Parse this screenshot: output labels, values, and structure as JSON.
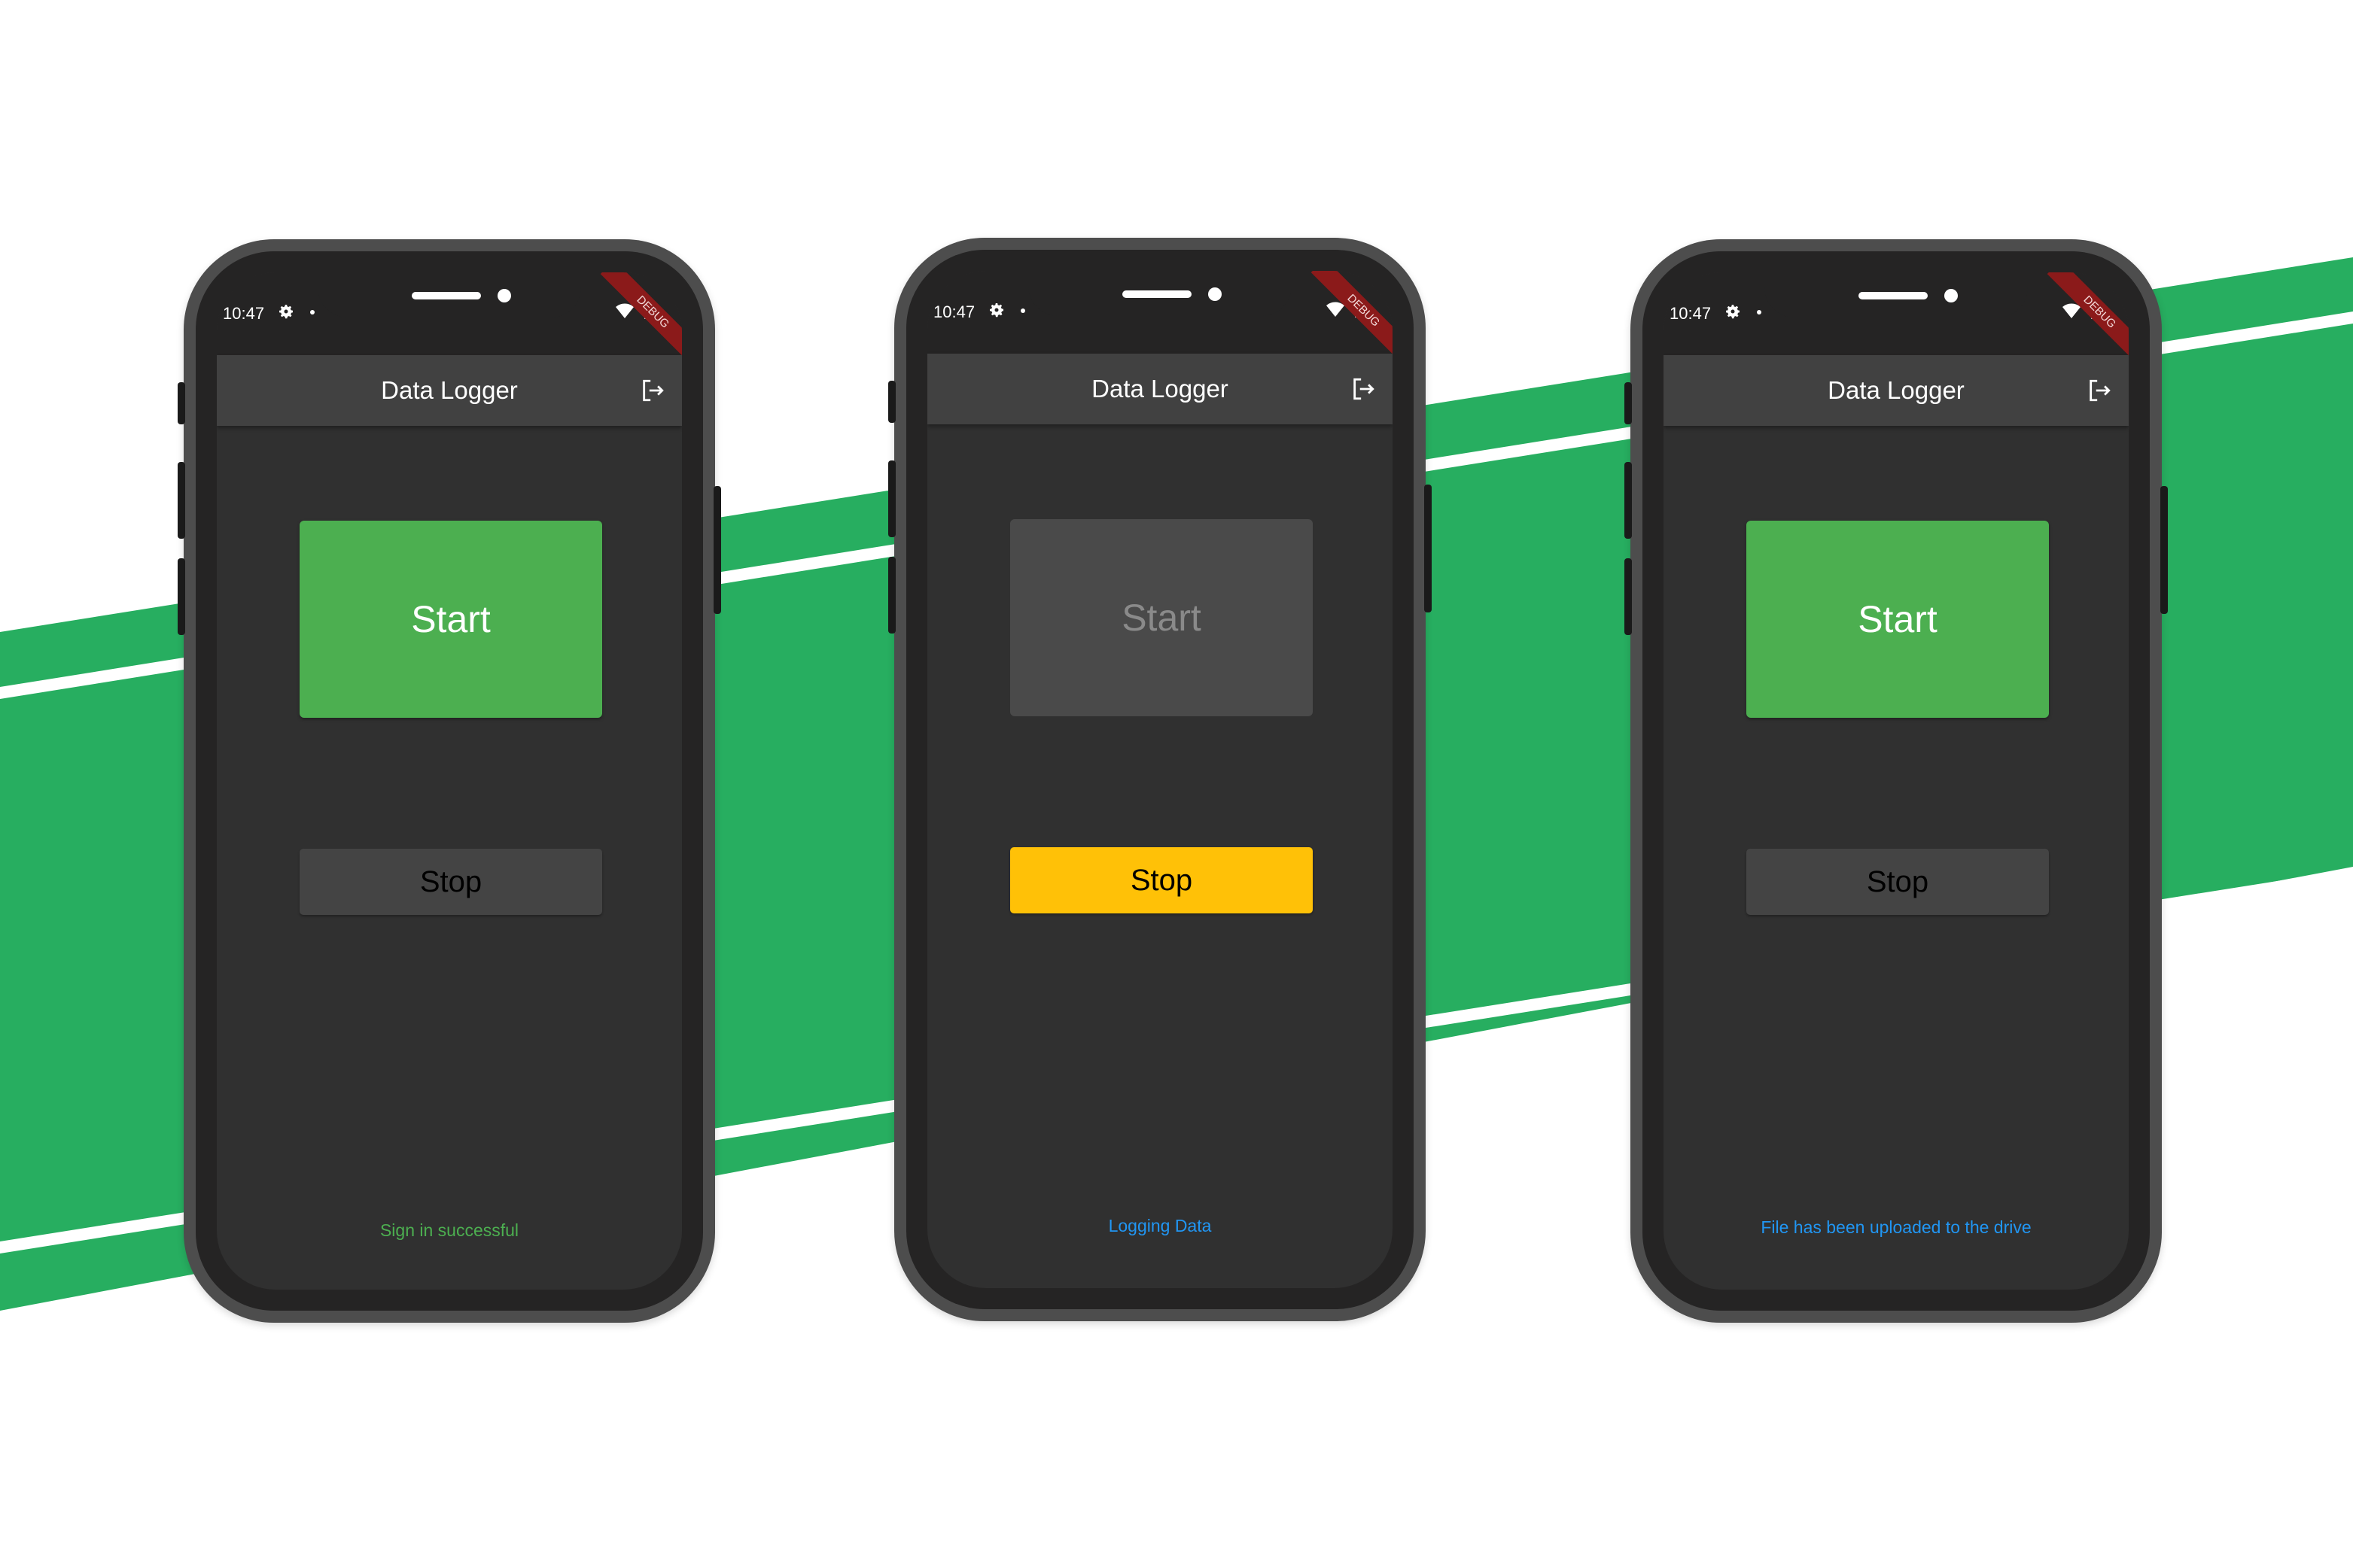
{
  "colors": {
    "background": "#ffffff",
    "stripe": "#27ae60",
    "phone_body": "#4d4d4d",
    "screen": "#303030",
    "appbar": "#414141",
    "start_enabled": "#4caf50",
    "start_disabled": "#4a4a4a",
    "stop_disabled": "#444444",
    "stop_enabled": "#ffc107"
  },
  "phones": [
    {
      "status_bar": {
        "time": "10:47",
        "debug_banner": "DEBUG"
      },
      "app_bar": {
        "title": "Data Logger",
        "action_icon": "logout-icon"
      },
      "start_button": {
        "label": "Start",
        "enabled": true
      },
      "stop_button": {
        "label": "Stop",
        "enabled": false
      },
      "status_message": {
        "text": "Sign in successful",
        "color": "#4caf50"
      }
    },
    {
      "status_bar": {
        "time": "10:47",
        "debug_banner": "DEBUG"
      },
      "app_bar": {
        "title": "Data Logger",
        "action_icon": "logout-icon"
      },
      "start_button": {
        "label": "Start",
        "enabled": false
      },
      "stop_button": {
        "label": "Stop",
        "enabled": true
      },
      "status_message": {
        "text": "Logging Data",
        "color": "#2196f3"
      }
    },
    {
      "status_bar": {
        "time": "10:47",
        "debug_banner": "DEBUG"
      },
      "app_bar": {
        "title": "Data Logger",
        "action_icon": "logout-icon"
      },
      "start_button": {
        "label": "Start",
        "enabled": true
      },
      "stop_button": {
        "label": "Stop",
        "enabled": false
      },
      "status_message": {
        "text": "File has been uploaded to the drive",
        "color": "#2196f3"
      }
    }
  ]
}
